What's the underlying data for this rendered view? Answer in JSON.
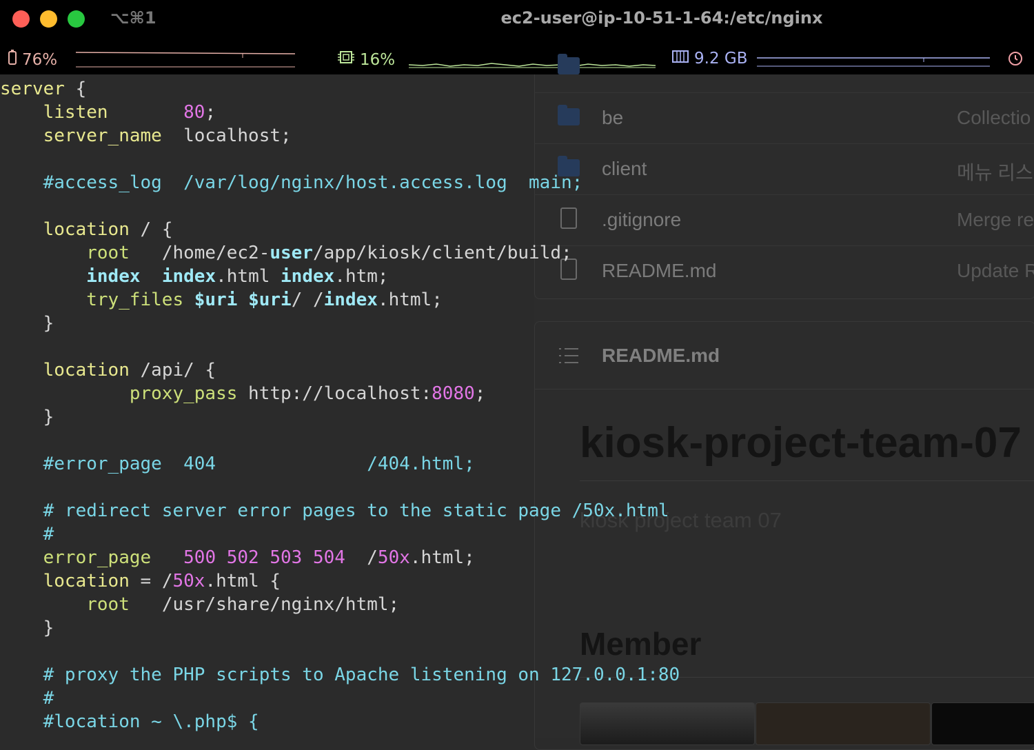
{
  "window": {
    "shortcut": "⌥⌘1",
    "title": "ec2-user@ip-10-51-1-64:/etc/nginx"
  },
  "status": {
    "battery": "76%",
    "cpu": "16%",
    "memory": "9.2 GB",
    "colors": {
      "battery": "#e6b0a8",
      "cpu": "#bde69a",
      "memory": "#aab2f4",
      "clock": "#f0a0a6"
    }
  },
  "browser": {
    "files": [
      {
        "name": "be",
        "message": "Collectio",
        "type": "folder"
      },
      {
        "name": "client",
        "message": "메뉴 리스트",
        "type": "folder"
      },
      {
        "name": ".gitignore",
        "message": "Merge re",
        "type": "file"
      },
      {
        "name": "README.md",
        "message": "Update R",
        "type": "file"
      }
    ],
    "readme": {
      "header": "README.md",
      "title": "kiosk-project-team-07",
      "description": "kiosk project team 07",
      "section": "Member"
    }
  },
  "code": {
    "lines": [
      [
        [
          "y",
          "server"
        ],
        [
          "t",
          " {"
        ]
      ],
      [
        [
          "t",
          "    "
        ],
        [
          "y",
          "listen"
        ],
        [
          "t",
          "       "
        ],
        [
          "m",
          "80"
        ],
        [
          "t",
          ";"
        ]
      ],
      [
        [
          "t",
          "    "
        ],
        [
          "y",
          "server_name"
        ],
        [
          "t",
          "  localhost;"
        ]
      ],
      [
        [
          "t",
          ""
        ]
      ],
      [
        [
          "t",
          "    "
        ],
        [
          "c",
          "#access_log  /var/log/nginx/host.access.log  main;"
        ]
      ],
      [
        [
          "t",
          ""
        ]
      ],
      [
        [
          "t",
          "    "
        ],
        [
          "y",
          "location"
        ],
        [
          "t",
          " / {"
        ]
      ],
      [
        [
          "t",
          "        "
        ],
        [
          "g",
          "root"
        ],
        [
          "t",
          "   /home/ec2-"
        ],
        [
          "kb",
          "user"
        ],
        [
          "t",
          "/app/kiosk/client/build;"
        ]
      ],
      [
        [
          "t",
          "        "
        ],
        [
          "kb",
          "index"
        ],
        [
          "t",
          "  "
        ],
        [
          "kb",
          "index"
        ],
        [
          "t",
          ".html "
        ],
        [
          "kb",
          "index"
        ],
        [
          "t",
          ".htm;"
        ]
      ],
      [
        [
          "t",
          "        "
        ],
        [
          "g",
          "try_files"
        ],
        [
          "t",
          " "
        ],
        [
          "kb",
          "$uri"
        ],
        [
          "t",
          " "
        ],
        [
          "kb",
          "$uri"
        ],
        [
          "t",
          "/ /"
        ],
        [
          "kb",
          "index"
        ],
        [
          "t",
          ".html;"
        ]
      ],
      [
        [
          "t",
          "    }"
        ]
      ],
      [
        [
          "t",
          ""
        ]
      ],
      [
        [
          "t",
          "    "
        ],
        [
          "y",
          "location"
        ],
        [
          "t",
          " /api/ {"
        ]
      ],
      [
        [
          "t",
          "            "
        ],
        [
          "g",
          "proxy_pass"
        ],
        [
          "t",
          " http://localhost:"
        ],
        [
          "m",
          "8080"
        ],
        [
          "t",
          ";"
        ]
      ],
      [
        [
          "t",
          "    }"
        ]
      ],
      [
        [
          "t",
          ""
        ]
      ],
      [
        [
          "t",
          "    "
        ],
        [
          "c",
          "#error_page  404              /404.html;"
        ]
      ],
      [
        [
          "t",
          ""
        ]
      ],
      [
        [
          "t",
          "    "
        ],
        [
          "c",
          "# redirect server error pages to the static page /50x.html"
        ]
      ],
      [
        [
          "t",
          "    "
        ],
        [
          "c",
          "#"
        ]
      ],
      [
        [
          "t",
          "    "
        ],
        [
          "g",
          "error_page"
        ],
        [
          "t",
          "   "
        ],
        [
          "m",
          "500 502 503 504"
        ],
        [
          "t",
          "  /"
        ],
        [
          "m",
          "50x"
        ],
        [
          "t",
          ".html;"
        ]
      ],
      [
        [
          "t",
          "    "
        ],
        [
          "y",
          "location"
        ],
        [
          "t",
          " = /"
        ],
        [
          "m",
          "50x"
        ],
        [
          "t",
          ".html {"
        ]
      ],
      [
        [
          "t",
          "        "
        ],
        [
          "g",
          "root"
        ],
        [
          "t",
          "   /usr/share/nginx/html;"
        ]
      ],
      [
        [
          "t",
          "    }"
        ]
      ],
      [
        [
          "t",
          ""
        ]
      ],
      [
        [
          "t",
          "    "
        ],
        [
          "c",
          "# proxy the PHP scripts to Apache listening on 127.0.0.1:80"
        ]
      ],
      [
        [
          "t",
          "    "
        ],
        [
          "c",
          "#"
        ]
      ],
      [
        [
          "t",
          "    "
        ],
        [
          "c",
          "#location ~ \\.php$ {"
        ]
      ]
    ]
  }
}
